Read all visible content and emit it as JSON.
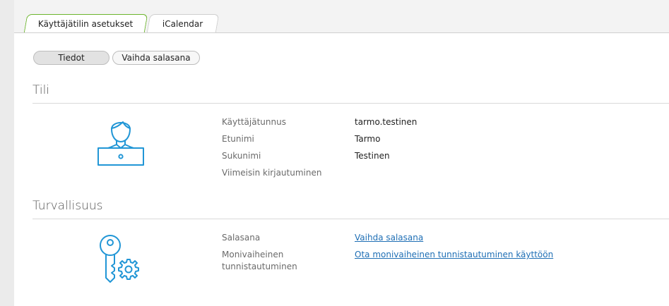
{
  "tabs": [
    {
      "label": "Käyttäjätilin asetukset",
      "active": true
    },
    {
      "label": "iCalendar",
      "active": false
    }
  ],
  "subtabs": [
    {
      "label": "Tiedot",
      "active": true
    },
    {
      "label": "Vaihda salasana",
      "active": false
    }
  ],
  "account": {
    "title": "Tili",
    "icon": "user-laptop-icon",
    "fields": [
      {
        "label": "Käyttäjätunnus",
        "value": "tarmo.testinen"
      },
      {
        "label": "Etunimi",
        "value": "Tarmo"
      },
      {
        "label": "Sukunimi",
        "value": "Testinen"
      },
      {
        "label": "Viimeisin kirjautuminen",
        "value": ""
      }
    ]
  },
  "security": {
    "title": "Turvallisuus",
    "icon": "key-gear-icon",
    "password_label": "Salasana",
    "password_link": "Vaihda salasana",
    "mfa_label_line1": "Monivaiheinen",
    "mfa_label_line2": "tunnistautuminen",
    "mfa_link": "Ota monivaiheinen tunnistautuminen käyttöön"
  },
  "colors": {
    "icon_blue": "#2196d6",
    "active_tab_border": "#6cb52d",
    "link": "#1f6fb5"
  }
}
